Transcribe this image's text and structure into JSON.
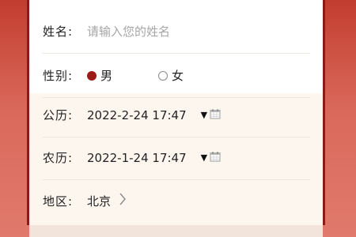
{
  "form": {
    "name": {
      "label": "姓名:",
      "placeholder": "请输入您的姓名"
    },
    "gender": {
      "label": "性别:",
      "options": [
        {
          "label": "男",
          "selected": true
        },
        {
          "label": "女",
          "selected": false
        }
      ]
    },
    "solar": {
      "label": "公历:",
      "value": "2022-2-24 17:47"
    },
    "lunar": {
      "label": "农历:",
      "value": "2022-1-24 17:47"
    },
    "region": {
      "label": "地区:",
      "value": "北京"
    }
  },
  "colors": {
    "accent": "#9b1b16",
    "border": "#8c1a16",
    "background_top": "#c23d2f",
    "background_bottom": "#e17a6c"
  },
  "icons": {
    "dropdown": "triangle-down-icon",
    "calendar": "calendar-icon",
    "chevron": "chevron-right-icon"
  }
}
